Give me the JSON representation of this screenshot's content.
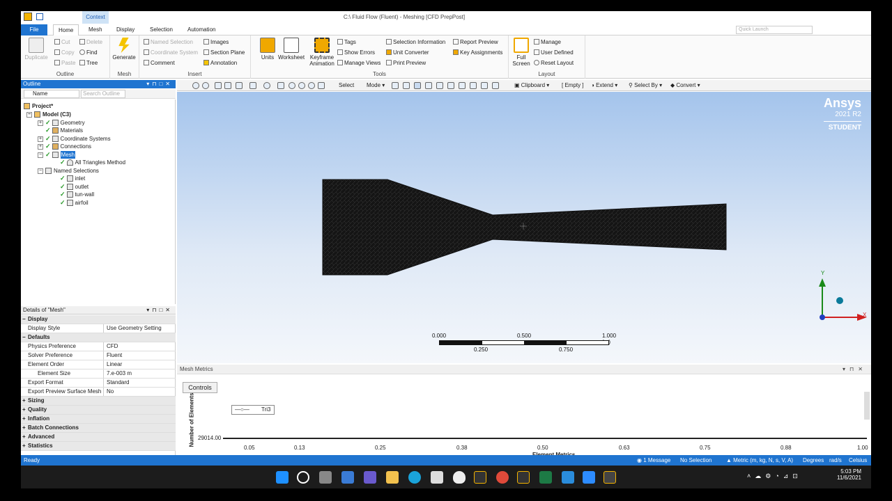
{
  "window": {
    "title": "C:\\ Fluid Flow (Fluent) - Meshing [CFD PrepPost]",
    "context_tab": "Context"
  },
  "tabs": [
    "File",
    "Home",
    "Mesh",
    "Display",
    "Selection",
    "Automation"
  ],
  "quick_launch_placeholder": "Quick Launch",
  "ribbon": {
    "outline": {
      "label": "Outline",
      "duplicate": "Duplicate",
      "cut": "Cut",
      "copy": "Copy",
      "paste": "Paste",
      "delete": "Delete",
      "find": "Find",
      "tree": "Tree"
    },
    "mesh": {
      "label": "Mesh",
      "generate": "Generate"
    },
    "insert": {
      "label": "Insert",
      "named_selection": "Named Selection",
      "coordinate_system": "Coordinate System",
      "comment": "Comment",
      "images": "Images",
      "section_plane": "Section Plane",
      "annotation": "Annotation"
    },
    "tools": {
      "label": "Tools",
      "units": "Units",
      "worksheet": "Worksheet",
      "keyframe": "Keyframe",
      "animation": "Animation",
      "tags": "Tags",
      "show_errors": "Show Errors",
      "manage_views": "Manage Views",
      "selection_information": "Selection Information",
      "unit_converter": "Unit Converter",
      "print_preview": "Print Preview",
      "report_preview": "Report Preview",
      "key_assignments": "Key Assignments"
    },
    "layout": {
      "label": "Layout",
      "full": "Full",
      "screen": "Screen",
      "manage": "Manage",
      "user_defined": "User Defined",
      "reset_layout": "Reset Layout"
    }
  },
  "outline": {
    "title": "Outline",
    "name_filter": "Name",
    "search_placeholder": "Search Outline",
    "tree": {
      "project": "Project*",
      "model": "Model (C3)",
      "geometry": "Geometry",
      "materials": "Materials",
      "coordinate_systems": "Coordinate Systems",
      "connections": "Connections",
      "mesh": "Mesh",
      "all_triangles": "All Triangles Method",
      "named_selections": "Named Selections",
      "inlet": "inlet",
      "outlet": "outlet",
      "tun_wall": "tun-wall",
      "airfoil": "airfoil"
    }
  },
  "details": {
    "title": "Details of \"Mesh\"",
    "display": "Display",
    "display_style_k": "Display Style",
    "display_style_v": "Use Geometry Setting",
    "defaults": "Defaults",
    "physics_k": "Physics Preference",
    "physics_v": "CFD",
    "solver_k": "Solver Preference",
    "solver_v": "Fluent",
    "order_k": "Element Order",
    "order_v": "Linear",
    "size_k": "Element Size",
    "size_v": "7.e-003 m",
    "format_k": "Export Format",
    "format_v": "Standard",
    "preview_k": "Export Preview Surface Mesh",
    "preview_v": "No",
    "sizing": "Sizing",
    "quality": "Quality",
    "inflation": "Inflation",
    "batch": "Batch Connections",
    "advanced": "Advanced",
    "statistics": "Statistics"
  },
  "graphics_toolbar": {
    "select": "Select",
    "mode": "Mode",
    "clipboard": "Clipboard",
    "empty": "[ Empty ]",
    "extend": "Extend",
    "select_by": "Select By",
    "convert": "Convert"
  },
  "viewport": {
    "brand": "Ansys",
    "version": "2021 R2",
    "edition": "STUDENT",
    "scale_top": [
      "0.000",
      "0.500",
      "1.000 (m)"
    ],
    "scale_bottom": [
      "0.250",
      "0.750"
    ],
    "axis_y": "Y",
    "axis_x": "X"
  },
  "mesh_metrics": {
    "title": "Mesh Metrics",
    "controls": "Controls",
    "legend": "Tri3",
    "y_label": "Number of Elements",
    "y_value": "29014.00",
    "x_label": "Element Metrics",
    "x_ticks": [
      "0.05",
      "0.13",
      "0.25",
      "0.38",
      "0.50",
      "0.63",
      "0.75",
      "0.88",
      "1.00"
    ]
  },
  "status": {
    "ready": "Ready",
    "message": "1 Message",
    "selection": "No Selection",
    "units": "Metric (m, kg, N, s, V, A)",
    "angle": "Degrees",
    "rate": "rad/s",
    "temp": "Celsius"
  },
  "taskbar": {
    "time": "5:03 PM",
    "date": "11/6/2021"
  },
  "colors": {
    "accent": "#1f74d0",
    "viewport_top": "#a4c4ec",
    "mesh": "#151515"
  }
}
